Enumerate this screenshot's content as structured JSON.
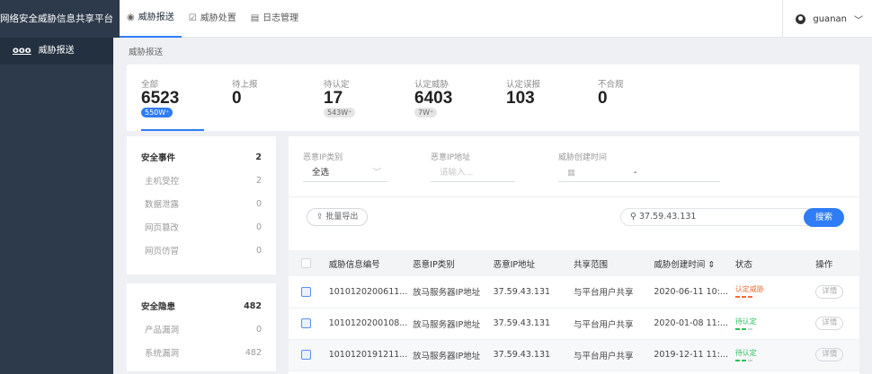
{
  "app": {
    "brand": "网络安全威胁信息共享平台"
  },
  "topnav": [
    {
      "label": "威胁报送",
      "icon": "◉",
      "active": true
    },
    {
      "label": "威胁处置",
      "icon": "☑",
      "active": false
    },
    {
      "label": "日志管理",
      "icon": "▤",
      "active": false
    }
  ],
  "user": {
    "name": "guanan"
  },
  "sidebar": {
    "items": [
      {
        "label": "威胁报送",
        "icon": "ooo"
      }
    ]
  },
  "breadcrumb": "威胁报送",
  "stats": [
    {
      "label": "全部",
      "value": "6523",
      "badge": "550W⁺",
      "active": true
    },
    {
      "label": "待上报",
      "value": "0",
      "badge": ""
    },
    {
      "label": "待认定",
      "value": "17",
      "badge": "543W⁺"
    },
    {
      "label": "认定威胁",
      "value": "6403",
      "badge": "7W⁺"
    },
    {
      "label": "认定误报",
      "value": "103",
      "badge": ""
    },
    {
      "label": "不合规",
      "value": "0",
      "badge": ""
    }
  ],
  "categories": {
    "group1": {
      "title": "安全事件",
      "count": "2",
      "items": [
        {
          "label": "主机受控",
          "count": "2"
        },
        {
          "label": "数据泄露",
          "count": "0"
        },
        {
          "label": "网页篡改",
          "count": "0"
        },
        {
          "label": "网页仿冒",
          "count": "0"
        }
      ]
    },
    "group2": {
      "title": "安全隐患",
      "count": "482",
      "items": [
        {
          "label": "产品漏洞",
          "count": "0"
        },
        {
          "label": "系统漏洞",
          "count": "482"
        }
      ]
    }
  },
  "filters": {
    "ip_type_label": "恶意IP类别",
    "ip_type_value": "全选",
    "ip_addr_label": "恶意IP地址",
    "ip_addr_placeholder": "请输入...",
    "time_label": "威胁创建时间",
    "time_sep": "-"
  },
  "toolbar": {
    "export_label": "批量导出",
    "search_value": "37.59.43.131",
    "search_button": "搜索"
  },
  "table": {
    "headers": [
      "威胁信息编号",
      "恶意IP类别",
      "恶意IP地址",
      "共享范围",
      "威胁创建时间 ⇕",
      "状态",
      "操作"
    ],
    "rows": [
      {
        "id": "1010120200611...",
        "type": "放马服务器IP地址",
        "ip": "37.59.43.131",
        "scope": "与平台用户共享",
        "time": "2020-06-11 10:...",
        "status": "认定威胁",
        "status_color": "#f26b3a",
        "action": "详情"
      },
      {
        "id": "1010120200108...",
        "type": "放马服务器IP地址",
        "ip": "37.59.43.131",
        "scope": "与平台用户共享",
        "time": "2020-01-08 11:...",
        "status": "待认定",
        "status_color": "#2cbf5c",
        "action": "详情"
      },
      {
        "id": "1010120191211...",
        "type": "放马服务器IP地址",
        "ip": "37.59.43.131",
        "scope": "与平台用户共享",
        "time": "2019-12-11 11:...",
        "status": "待认定",
        "status_color": "#2cbf5c",
        "action": "详情"
      }
    ]
  }
}
